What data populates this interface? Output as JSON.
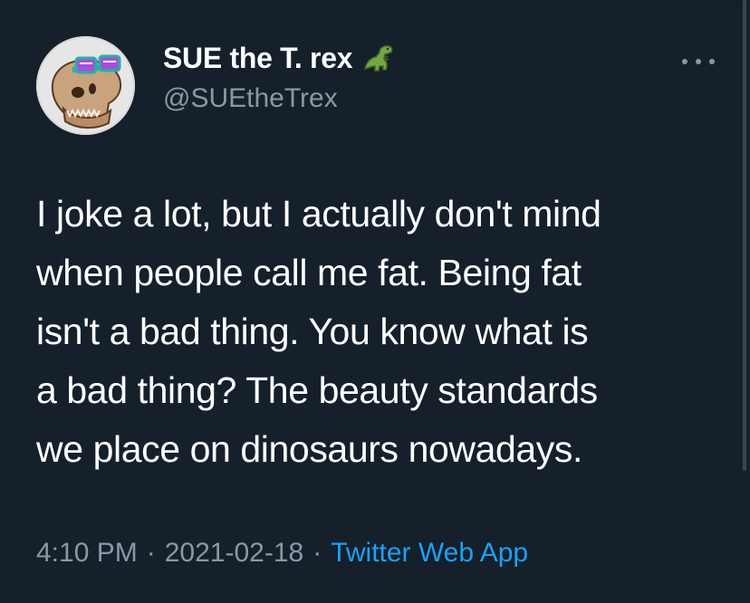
{
  "tweet": {
    "author": {
      "display_name": "SUE the T. rex",
      "name_emoji": "t-rex-emoji",
      "handle": "@SUEtheTrex",
      "avatar_icon": "t-rex-skull-with-sunglasses"
    },
    "text_lines": [
      "I joke a lot, but I actually don't mind",
      "when people call me fat. Being fat",
      "isn't a bad thing. You know what is",
      "a bad thing? The beauty standards",
      "we place on dinosaurs nowadays."
    ],
    "time": "4:10 PM",
    "date": "2021-02-18",
    "separator": "·",
    "source": "Twitter Web App",
    "more_icon": "more-options-icon"
  },
  "colors": {
    "background": "#15202b",
    "text": "#ffffff",
    "secondary_text": "#8899a6",
    "link": "#1da1f2"
  }
}
